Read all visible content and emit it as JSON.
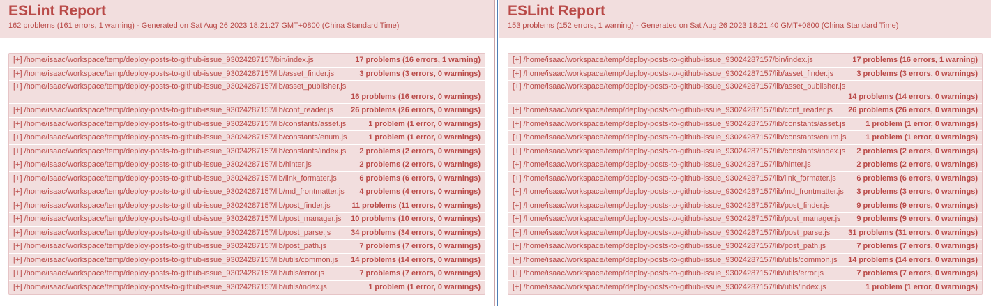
{
  "left": {
    "title": "ESLint Report",
    "summary": "162 problems (161 errors, 1 warning) - Generated on Sat Aug 26 2023 18:21:27 GMT+0800 (China Standard Time)",
    "files": [
      {
        "toggle": "[+]",
        "path": "/home/isaac/workspace/temp/deploy-posts-to-github-issue_93024287157/bin/index.js",
        "count": "17 problems (16 errors, 1 warning)"
      },
      {
        "toggle": "[+]",
        "path": "/home/isaac/workspace/temp/deploy-posts-to-github-issue_93024287157/lib/asset_finder.js",
        "count": "3 problems (3 errors, 0 warnings)"
      },
      {
        "toggle": "[+]",
        "path": "/home/isaac/workspace/temp/deploy-posts-to-github-issue_93024287157/lib/asset_publisher.js",
        "count": "16 problems (16 errors, 0 warnings)"
      },
      {
        "toggle": "[+]",
        "path": "/home/isaac/workspace/temp/deploy-posts-to-github-issue_93024287157/lib/conf_reader.js",
        "count": "26 problems (26 errors, 0 warnings)"
      },
      {
        "toggle": "[+]",
        "path": "/home/isaac/workspace/temp/deploy-posts-to-github-issue_93024287157/lib/constants/asset.js",
        "count": "1 problem (1 error, 0 warnings)"
      },
      {
        "toggle": "[+]",
        "path": "/home/isaac/workspace/temp/deploy-posts-to-github-issue_93024287157/lib/constants/enum.js",
        "count": "1 problem (1 error, 0 warnings)"
      },
      {
        "toggle": "[+]",
        "path": "/home/isaac/workspace/temp/deploy-posts-to-github-issue_93024287157/lib/constants/index.js",
        "count": "2 problems (2 errors, 0 warnings)"
      },
      {
        "toggle": "[+]",
        "path": "/home/isaac/workspace/temp/deploy-posts-to-github-issue_93024287157/lib/hinter.js",
        "count": "2 problems (2 errors, 0 warnings)"
      },
      {
        "toggle": "[+]",
        "path": "/home/isaac/workspace/temp/deploy-posts-to-github-issue_93024287157/lib/link_formater.js",
        "count": "6 problems (6 errors, 0 warnings)"
      },
      {
        "toggle": "[+]",
        "path": "/home/isaac/workspace/temp/deploy-posts-to-github-issue_93024287157/lib/md_frontmatter.js",
        "count": "4 problems (4 errors, 0 warnings)"
      },
      {
        "toggle": "[+]",
        "path": "/home/isaac/workspace/temp/deploy-posts-to-github-issue_93024287157/lib/post_finder.js",
        "count": "11 problems (11 errors, 0 warnings)"
      },
      {
        "toggle": "[+]",
        "path": "/home/isaac/workspace/temp/deploy-posts-to-github-issue_93024287157/lib/post_manager.js",
        "count": "10 problems (10 errors, 0 warnings)"
      },
      {
        "toggle": "[+]",
        "path": "/home/isaac/workspace/temp/deploy-posts-to-github-issue_93024287157/lib/post_parse.js",
        "count": "34 problems (34 errors, 0 warnings)"
      },
      {
        "toggle": "[+]",
        "path": "/home/isaac/workspace/temp/deploy-posts-to-github-issue_93024287157/lib/post_path.js",
        "count": "7 problems (7 errors, 0 warnings)"
      },
      {
        "toggle": "[+]",
        "path": "/home/isaac/workspace/temp/deploy-posts-to-github-issue_93024287157/lib/utils/common.js",
        "count": "14 problems (14 errors, 0 warnings)"
      },
      {
        "toggle": "[+]",
        "path": "/home/isaac/workspace/temp/deploy-posts-to-github-issue_93024287157/lib/utils/error.js",
        "count": "7 problems (7 errors, 0 warnings)"
      },
      {
        "toggle": "[+]",
        "path": "/home/isaac/workspace/temp/deploy-posts-to-github-issue_93024287157/lib/utils/index.js",
        "count": "1 problem (1 error, 0 warnings)"
      }
    ]
  },
  "right": {
    "title": "ESLint Report",
    "summary": "153 problems (152 errors, 1 warning) - Generated on Sat Aug 26 2023 18:21:40 GMT+0800 (China Standard Time)",
    "files": [
      {
        "toggle": "[+]",
        "path": "/home/isaac/workspace/temp/deploy-posts-to-github-issue_93024287157/bin/index.js",
        "count": "17 problems (16 errors, 1 warning)"
      },
      {
        "toggle": "[+]",
        "path": "/home/isaac/workspace/temp/deploy-posts-to-github-issue_93024287157/lib/asset_finder.js",
        "count": "3 problems (3 errors, 0 warnings)"
      },
      {
        "toggle": "[+]",
        "path": "/home/isaac/workspace/temp/deploy-posts-to-github-issue_93024287157/lib/asset_publisher.js",
        "count": "14 problems (14 errors, 0 warnings)"
      },
      {
        "toggle": "[+]",
        "path": "/home/isaac/workspace/temp/deploy-posts-to-github-issue_93024287157/lib/conf_reader.js",
        "count": "26 problems (26 errors, 0 warnings)"
      },
      {
        "toggle": "[+]",
        "path": "/home/isaac/workspace/temp/deploy-posts-to-github-issue_93024287157/lib/constants/asset.js",
        "count": "1 problem (1 error, 0 warnings)"
      },
      {
        "toggle": "[+]",
        "path": "/home/isaac/workspace/temp/deploy-posts-to-github-issue_93024287157/lib/constants/enum.js",
        "count": "1 problem (1 error, 0 warnings)"
      },
      {
        "toggle": "[+]",
        "path": "/home/isaac/workspace/temp/deploy-posts-to-github-issue_93024287157/lib/constants/index.js",
        "count": "2 problems (2 errors, 0 warnings)"
      },
      {
        "toggle": "[+]",
        "path": "/home/isaac/workspace/temp/deploy-posts-to-github-issue_93024287157/lib/hinter.js",
        "count": "2 problems (2 errors, 0 warnings)"
      },
      {
        "toggle": "[+]",
        "path": "/home/isaac/workspace/temp/deploy-posts-to-github-issue_93024287157/lib/link_formater.js",
        "count": "6 problems (6 errors, 0 warnings)"
      },
      {
        "toggle": "[+]",
        "path": "/home/isaac/workspace/temp/deploy-posts-to-github-issue_93024287157/lib/md_frontmatter.js",
        "count": "3 problems (3 errors, 0 warnings)"
      },
      {
        "toggle": "[+]",
        "path": "/home/isaac/workspace/temp/deploy-posts-to-github-issue_93024287157/lib/post_finder.js",
        "count": "9 problems (9 errors, 0 warnings)"
      },
      {
        "toggle": "[+]",
        "path": "/home/isaac/workspace/temp/deploy-posts-to-github-issue_93024287157/lib/post_manager.js",
        "count": "9 problems (9 errors, 0 warnings)"
      },
      {
        "toggle": "[+]",
        "path": "/home/isaac/workspace/temp/deploy-posts-to-github-issue_93024287157/lib/post_parse.js",
        "count": "31 problems (31 errors, 0 warnings)"
      },
      {
        "toggle": "[+]",
        "path": "/home/isaac/workspace/temp/deploy-posts-to-github-issue_93024287157/lib/post_path.js",
        "count": "7 problems (7 errors, 0 warnings)"
      },
      {
        "toggle": "[+]",
        "path": "/home/isaac/workspace/temp/deploy-posts-to-github-issue_93024287157/lib/utils/common.js",
        "count": "14 problems (14 errors, 0 warnings)"
      },
      {
        "toggle": "[+]",
        "path": "/home/isaac/workspace/temp/deploy-posts-to-github-issue_93024287157/lib/utils/error.js",
        "count": "7 problems (7 errors, 0 warnings)"
      },
      {
        "toggle": "[+]",
        "path": "/home/isaac/workspace/temp/deploy-posts-to-github-issue_93024287157/lib/utils/index.js",
        "count": "1 problem (1 error, 0 warnings)"
      }
    ]
  }
}
